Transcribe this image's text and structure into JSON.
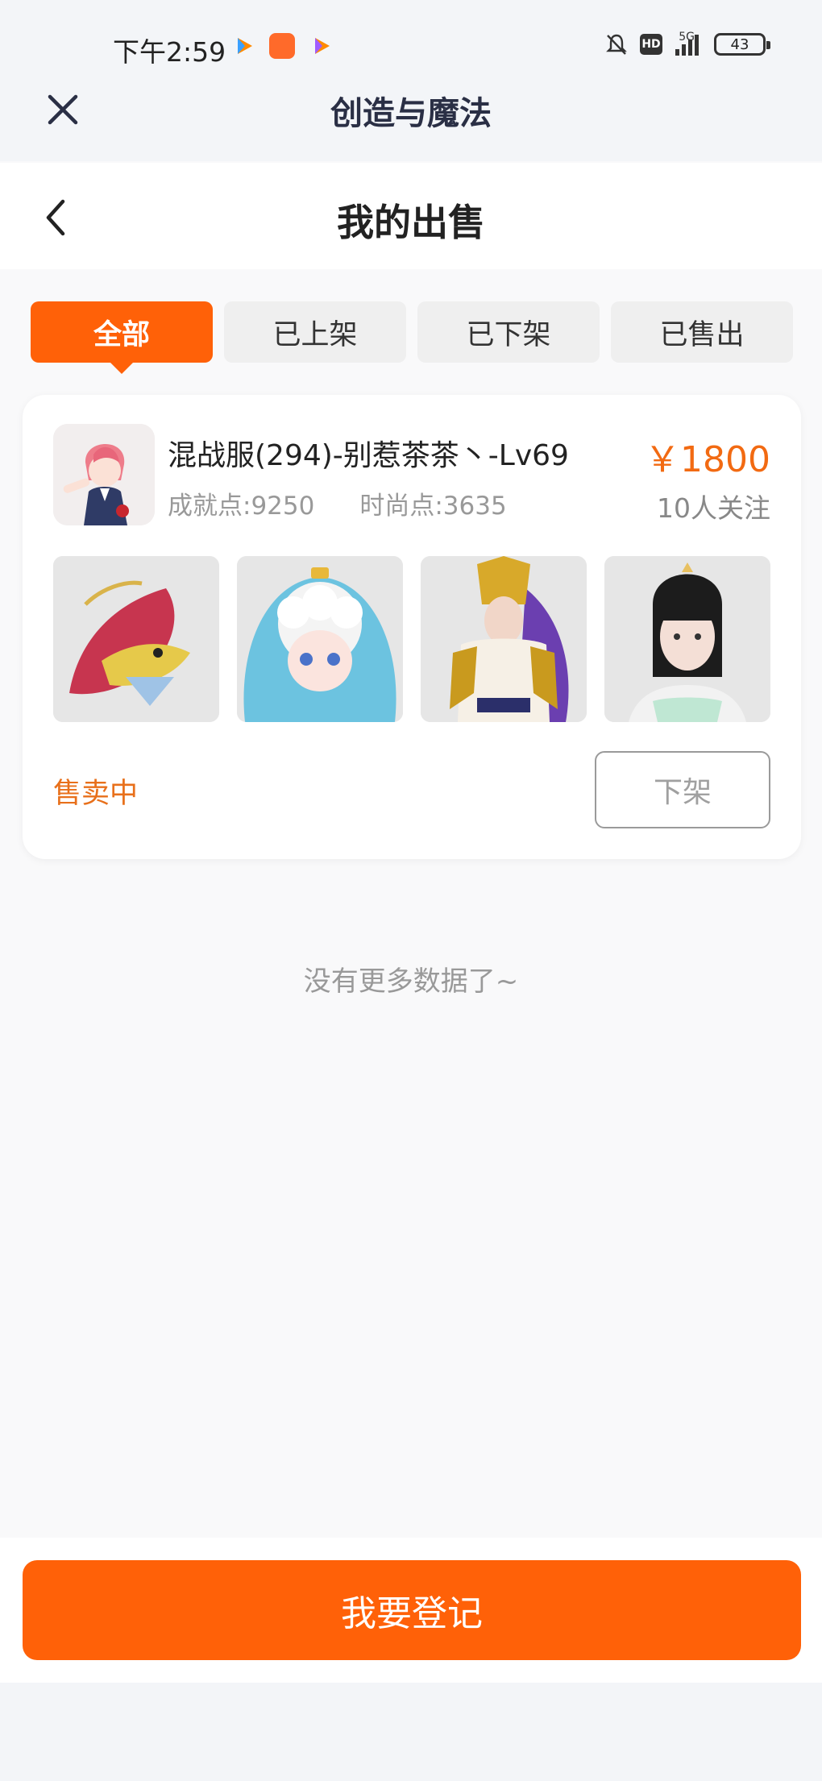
{
  "status_bar": {
    "time": "下午2:59",
    "network": "5G",
    "battery": "43",
    "icons": [
      "video-play-icon",
      "shop-icon",
      "video-play-icon",
      "mute-bell-icon",
      "hd-icon",
      "signal-icon",
      "battery-icon"
    ]
  },
  "app_bar": {
    "title": "创造与魔法",
    "close_icon": "close-icon"
  },
  "nav": {
    "title": "我的出售",
    "back_icon": "chevron-left-icon"
  },
  "tabs": [
    {
      "label": "全部",
      "active": true
    },
    {
      "label": "已上架",
      "active": false
    },
    {
      "label": "已下架",
      "active": false
    },
    {
      "label": "已售出",
      "active": false
    }
  ],
  "listing": {
    "title": "混战服(294)-别惹茶茶丶-Lv69",
    "achievement": "成就点:9250",
    "fashion": "时尚点:3635",
    "price": "￥1800",
    "followers": "10人关注",
    "status": "售卖中",
    "delist_label": "下架",
    "thumbnails": [
      "dragon-mount-image",
      "blue-costume-image",
      "gold-armor-image",
      "ancient-dress-image"
    ]
  },
  "list_end": "没有更多数据了~",
  "footer": {
    "register_label": "我要登记"
  },
  "colors": {
    "accent": "#ff6108",
    "price": "#f26a12",
    "status": "#e8701b",
    "page_bg": "#f9f9fa"
  }
}
